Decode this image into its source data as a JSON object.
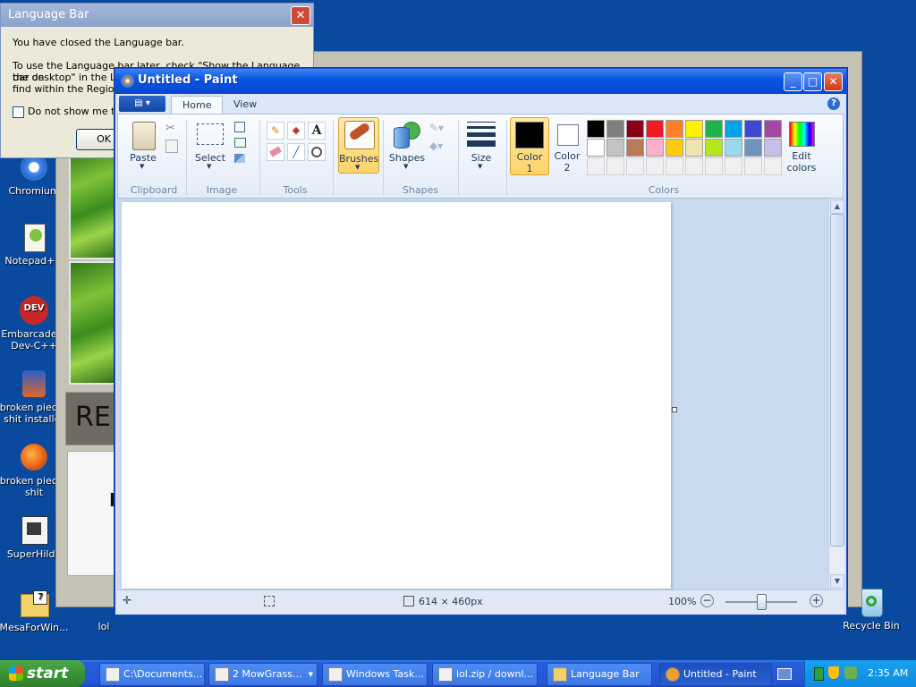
{
  "desktop": {
    "icons": [
      {
        "label": "Chromium"
      },
      {
        "label": "Notepad++"
      },
      {
        "label": "Embarcadero Dev-C++"
      },
      {
        "label": "broken pieces shit installer"
      },
      {
        "label": "broken pieces shit"
      },
      {
        "label": "SuperHilda"
      },
      {
        "label": "MesaForWin..."
      },
      {
        "label": "lol"
      },
      {
        "label": "Recycle Bin"
      }
    ]
  },
  "background_window": {
    "text_re": "RE",
    "text_f": "F"
  },
  "language_dialog": {
    "title": "Language Bar",
    "close_label": "✕",
    "line1": "You have closed the Language bar.",
    "line2": "To use the Language bar later, check \"Show the Language bar on",
    "line3": "the desktop\" in the Language bar settings, which you can",
    "line4": "find within the Regional and Language Options",
    "checkbox_label": "Do not show me this message again",
    "ok_label": "OK"
  },
  "paint": {
    "title": "Untitled - Paint",
    "minimize": "_",
    "maximize": "□",
    "close": "✕",
    "appmenu": "▤ ▾",
    "help": "?",
    "tabs": [
      {
        "label": "Home",
        "active": true
      },
      {
        "label": "View",
        "active": false
      }
    ],
    "ribbon": {
      "clipboard": {
        "group": "Clipboard",
        "paste": "Paste"
      },
      "image": {
        "group": "Image",
        "select": "Select"
      },
      "tools": {
        "group": "Tools"
      },
      "brushes": {
        "label": "Brushes"
      },
      "shapes": {
        "group": "Shapes",
        "label": "Shapes"
      },
      "size": {
        "label": "Size"
      },
      "colors": {
        "group": "Colors",
        "color1": "Color",
        "color1_num": "1",
        "color2": "Color",
        "color2_num": "2",
        "edit": "Edit",
        "edit2": "colors",
        "row1": [
          "#000000",
          "#7f7f7f",
          "#880015",
          "#ed1c24",
          "#ff7f27",
          "#fff200",
          "#22b14c",
          "#00a2e8",
          "#3f48cc",
          "#a349a4"
        ],
        "row2": [
          "#ffffff",
          "#c3c3c3",
          "#b97a57",
          "#ffaec9",
          "#ffc90e",
          "#efe4b0",
          "#b5e61d",
          "#99d9ea",
          "#7092be",
          "#c8bfe7"
        ],
        "row3": [
          "#f0f0f0",
          "#f0f0f0",
          "#f0f0f0",
          "#f0f0f0",
          "#f0f0f0",
          "#f0f0f0",
          "#f0f0f0",
          "#f0f0f0",
          "#f0f0f0",
          "#f0f0f0"
        ]
      }
    },
    "status": {
      "dimensions": "614 × 460px",
      "zoom": "100%"
    }
  },
  "taskbar": {
    "start": "start",
    "buttons": [
      {
        "label": "C:\\Documents..."
      },
      {
        "label": "2 MowGrass..."
      },
      {
        "label": "Windows Task..."
      },
      {
        "label": "lol.zip / downl..."
      },
      {
        "label": "Language Bar"
      },
      {
        "label": "Untitled - Paint"
      }
    ],
    "clock": "2:35 AM"
  }
}
